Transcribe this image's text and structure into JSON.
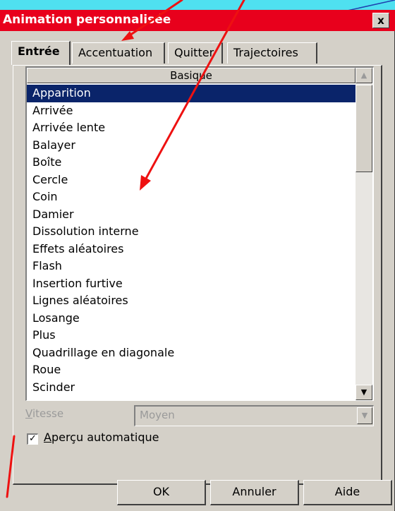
{
  "title": "Animation personnalisée",
  "close_label": "x",
  "tabs": [
    {
      "label": "Entrée",
      "active": true
    },
    {
      "label": "Accentuation",
      "active": false
    },
    {
      "label": "Quitter",
      "active": false
    },
    {
      "label": "Trajectoires",
      "active": false
    }
  ],
  "list": {
    "header": "Basique",
    "items": [
      "Apparition",
      "Arrivée",
      "Arrivée lente",
      "Balayer",
      "Boîte",
      "Cercle",
      "Coin",
      "Damier",
      "Dissolution interne",
      "Effets aléatoires",
      "Flash",
      "Insertion furtive",
      "Lignes aléatoires",
      "Losange",
      "Plus",
      "Quadrillage en diagonale",
      "Roue",
      "Scinder"
    ],
    "selected": "Apparition"
  },
  "speed": {
    "label_first": "V",
    "label_rest": "itesse",
    "value": "Moyen"
  },
  "preview": {
    "checked": true,
    "label_first": "A",
    "label_rest": "perçu automatique"
  },
  "buttons": {
    "ok": "OK",
    "cancel": "Annuler",
    "help": "Aide"
  },
  "colors": {
    "background": "#4fe0f0",
    "titlebar": "#e8001c",
    "annotation_arrows": "#ee1111",
    "selection": "#0a246a"
  }
}
